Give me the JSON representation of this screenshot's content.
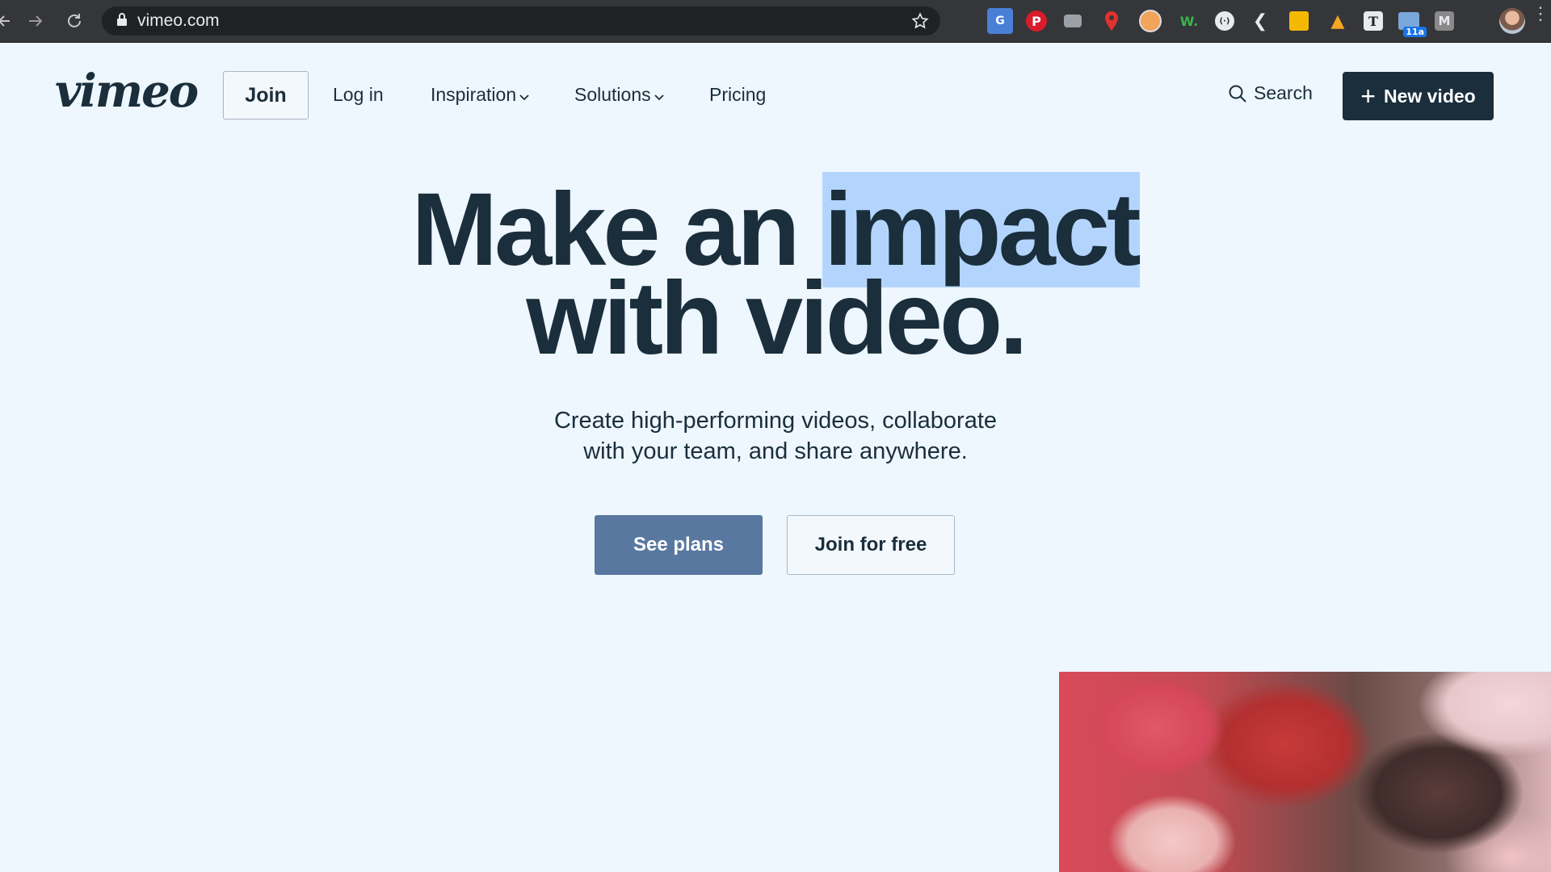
{
  "browser": {
    "url": "vimeo.com",
    "extensions": [
      {
        "name": "google-translate",
        "glyph": "G"
      },
      {
        "name": "pinterest",
        "glyph": "P"
      },
      {
        "name": "extension-grey",
        "glyph": ""
      },
      {
        "name": "maps-pin",
        "glyph": ""
      },
      {
        "name": "image-extension",
        "glyph": ""
      },
      {
        "name": "w-extension",
        "glyph": "W."
      },
      {
        "name": "circle-extension",
        "glyph": "(·)"
      },
      {
        "name": "back-chevron",
        "glyph": "❮"
      },
      {
        "name": "yellow-extension",
        "glyph": ""
      },
      {
        "name": "warning-triangle",
        "glyph": "▲"
      },
      {
        "name": "t-extension",
        "glyph": "T"
      },
      {
        "name": "calendar-extension",
        "glyph": "",
        "badge": "11a"
      },
      {
        "name": "m-extension",
        "glyph": "M"
      }
    ]
  },
  "header": {
    "logo": "vimeo",
    "join": "Join",
    "login": "Log in",
    "inspiration": "Inspiration",
    "solutions": "Solutions",
    "pricing": "Pricing",
    "search": "Search",
    "new_video": "New video"
  },
  "hero": {
    "title_part1": "Make an ",
    "title_highlight": "impact",
    "title_line2": "with video.",
    "subtitle_line1": "Create high-performing videos, collaborate",
    "subtitle_line2": "with your team, and share anywhere.",
    "see_plans": "See plans",
    "join_free": "Join for free"
  },
  "colors": {
    "page_bg": "#eef6fe",
    "text": "#1a2e3b",
    "highlight": "#b3d5fd",
    "primary_button": "#5878a0",
    "new_video_bg": "#1a2e3b"
  }
}
